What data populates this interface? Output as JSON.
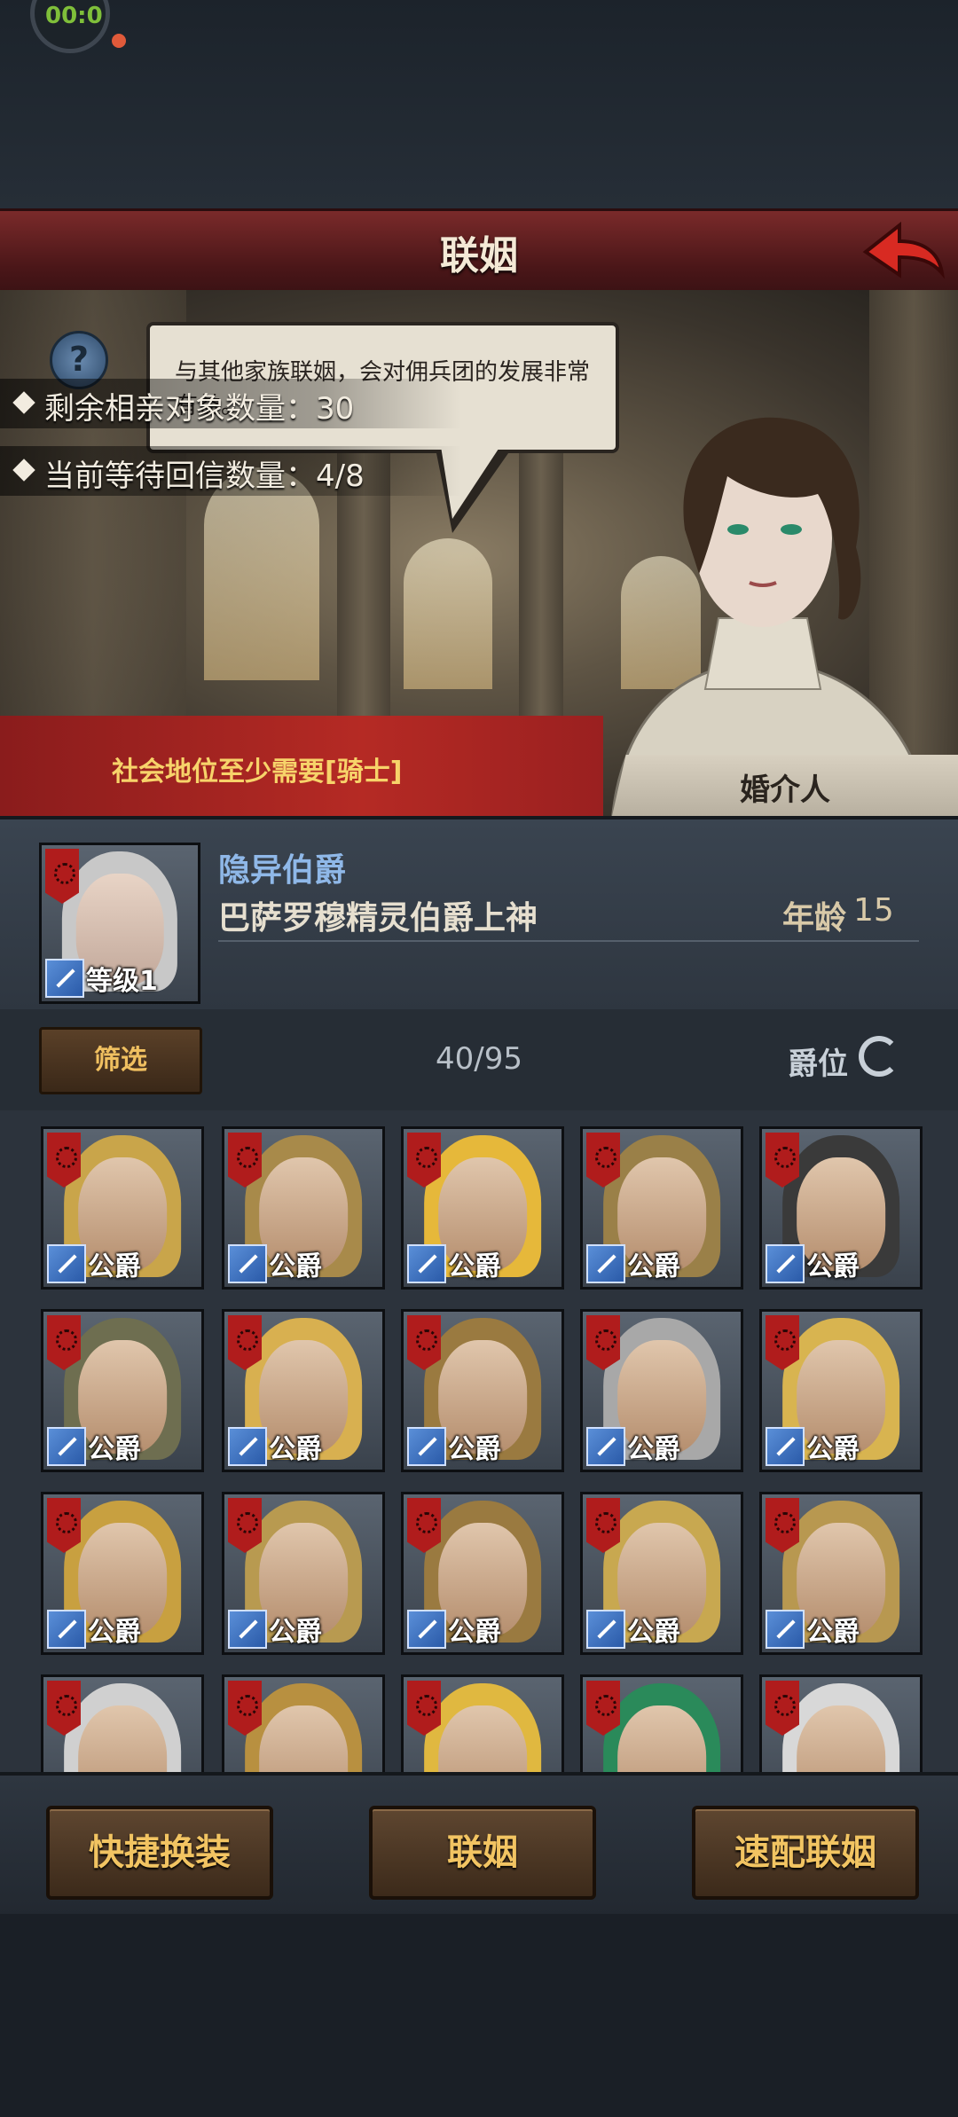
{
  "status": {
    "badge_text": "00:0",
    "indicator_color": "#e05a3a"
  },
  "header": {
    "title": "联姻"
  },
  "scene": {
    "dialogue": "与其他家族联姻，会对佣兵团的发展非常有益。",
    "remaining_label": "剩余相亲对象数量：30",
    "pending_label": "当前等待回信数量：4/8",
    "requirement": "社会地位至少需要[骑士]",
    "matchmaker": "婚介人"
  },
  "player": {
    "title": "隐异伯爵",
    "name": "巴萨罗穆精灵伯爵上神",
    "age_label": "年龄",
    "age": "15",
    "level": "等级1"
  },
  "filter": {
    "button": "筛选",
    "count": "40/95",
    "sort": "爵位"
  },
  "candidates": [
    {
      "rank": "公爵",
      "hair": "#c9a54a"
    },
    {
      "rank": "公爵",
      "hair": "#a88a4a"
    },
    {
      "rank": "公爵",
      "hair": "#e6b83a"
    },
    {
      "rank": "公爵",
      "hair": "#9a8048"
    },
    {
      "rank": "公爵",
      "hair": "#3a3a3a"
    },
    {
      "rank": "公爵",
      "hair": "#6e6e50"
    },
    {
      "rank": "公爵",
      "hair": "#d8b050"
    },
    {
      "rank": "公爵",
      "hair": "#9a7a40"
    },
    {
      "rank": "公爵",
      "hair": "#a8a8a8"
    },
    {
      "rank": "公爵",
      "hair": "#d8b450"
    },
    {
      "rank": "公爵",
      "hair": "#c8a040"
    },
    {
      "rank": "公爵",
      "hair": "#b89a50"
    },
    {
      "rank": "公爵",
      "hair": "#9a7a40"
    },
    {
      "rank": "公爵",
      "hair": "#c8a850"
    },
    {
      "rank": "公爵",
      "hair": "#b89850"
    },
    {
      "rank": "",
      "hair": "#d0d0d0"
    },
    {
      "rank": "",
      "hair": "#b89040"
    },
    {
      "rank": "",
      "hair": "#e0b840"
    },
    {
      "rank": "",
      "hair": "#2a8a5a"
    },
    {
      "rank": "",
      "hair": "#d8d8d8"
    }
  ],
  "actions": {
    "quick_outfit": "快捷换装",
    "marry": "联姻",
    "quick_match": "速配联姻"
  }
}
